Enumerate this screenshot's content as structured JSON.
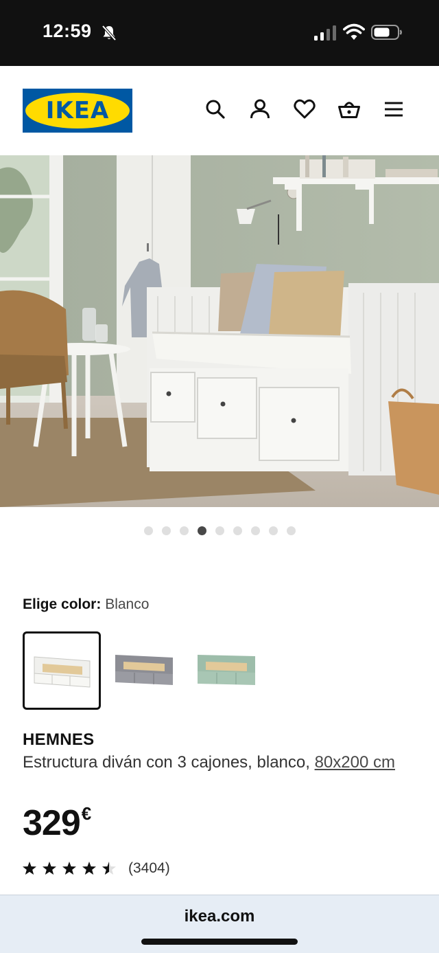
{
  "status_bar": {
    "time": "12:59",
    "icons": [
      "bell-slash-icon",
      "signal-icon",
      "wifi-icon",
      "battery-icon"
    ]
  },
  "header": {
    "logo_text": "IKEA",
    "icons": [
      "search-icon",
      "account-icon",
      "heart-icon",
      "basket-icon",
      "menu-icon"
    ]
  },
  "carousel": {
    "dot_count": 9,
    "active_index": 3
  },
  "color_selector": {
    "label": "Elige color:",
    "value": "Blanco",
    "swatches": [
      {
        "color": "#f2f2f0",
        "selected": true
      },
      {
        "color": "#8e8f96",
        "selected": false
      },
      {
        "color": "#9fbfae",
        "selected": false
      }
    ]
  },
  "product": {
    "name": "HEMNES",
    "description": "Estructura diván con 3 cajones, blanco, ",
    "size_link": "80x200 cm",
    "price_integer": "329",
    "price_currency": "€",
    "rating_value": 4.5,
    "rating_count": "(3404)"
  },
  "browser": {
    "url": "ikea.com"
  },
  "colors": {
    "ikea_blue": "#0058a3",
    "ikea_yellow": "#ffdb00",
    "wall": "#a9b3a1",
    "furniture_white": "#f1f1ee"
  }
}
